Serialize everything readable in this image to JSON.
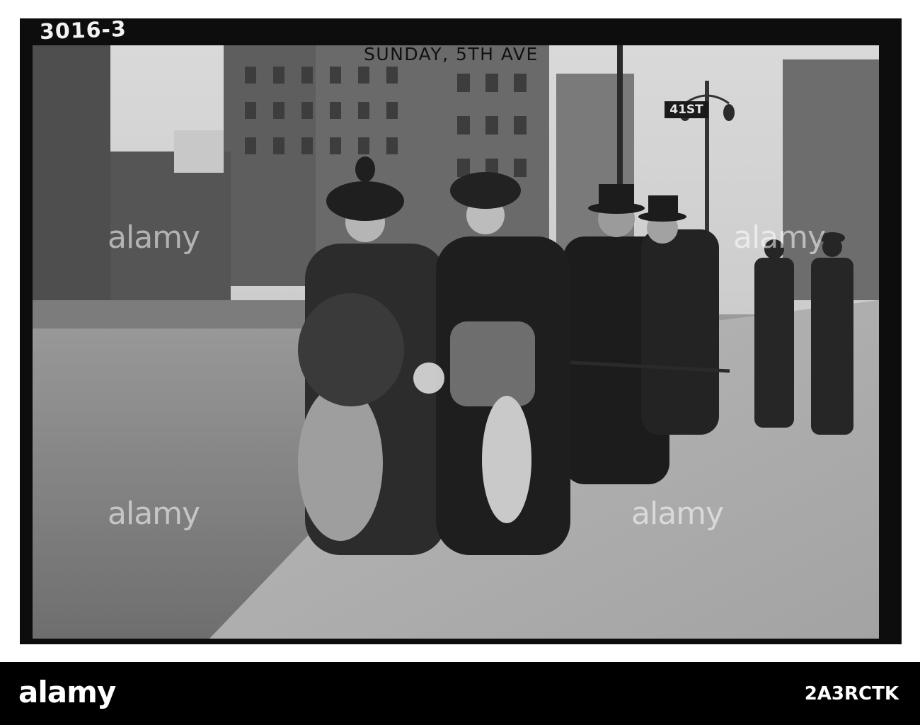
{
  "photo": {
    "plate_number": "3016-3",
    "caption": "SUNDAY, 5TH AVE",
    "street_sign": "41ST",
    "watermark": "alamy"
  },
  "footer": {
    "logo": "alamy",
    "image_id": "2A3RCTK"
  }
}
